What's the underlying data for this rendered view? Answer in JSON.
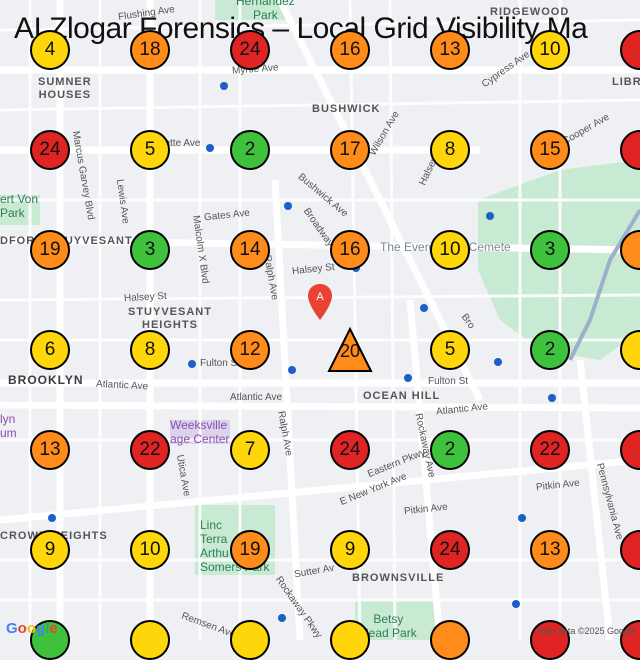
{
  "title": "AI Zlogar Forensics – Local Grid Visibility Ma",
  "colors": {
    "red": "#e02424",
    "orange": "#ff8c1a",
    "yellow": "#ffd60a",
    "green": "#3ec23e",
    "map_bg": "#eef0f3",
    "park": "#c9ead2"
  },
  "center_marker": {
    "value": "20",
    "shape": "triangle",
    "color": "orange"
  },
  "pin": {
    "label": "A"
  },
  "grid": [
    [
      "4",
      "18",
      "24",
      "16",
      "13",
      "10",
      ""
    ],
    [
      "24",
      "5",
      "2",
      "17",
      "8",
      "15",
      ""
    ],
    [
      "19",
      "3",
      "14",
      "16",
      "10",
      "3",
      ""
    ],
    [
      "6",
      "8",
      "12",
      "",
      "5",
      "2",
      ""
    ],
    [
      "13",
      "22",
      "7",
      "24",
      "2",
      "22",
      ""
    ],
    [
      "9",
      "10",
      "19",
      "9",
      "24",
      "13",
      ""
    ]
  ],
  "grid_colors": [
    [
      "yellow",
      "orange",
      "red",
      "orange",
      "orange",
      "yellow",
      "red"
    ],
    [
      "red",
      "yellow",
      "green",
      "orange",
      "yellow",
      "orange",
      "red"
    ],
    [
      "orange",
      "green",
      "orange",
      "orange",
      "yellow",
      "green",
      "orange"
    ],
    [
      "yellow",
      "yellow",
      "orange",
      "orange",
      "yellow",
      "green",
      "yellow"
    ],
    [
      "orange",
      "red",
      "yellow",
      "red",
      "green",
      "red",
      "red"
    ],
    [
      "yellow",
      "yellow",
      "orange",
      "yellow",
      "red",
      "orange",
      "red"
    ],
    [
      "green",
      "yellow",
      "yellow",
      "yellow",
      "orange",
      "red",
      "red"
    ]
  ],
  "neighborhoods": {
    "sumner_houses": "SUMNER\nHOUSES",
    "bushwick": "BUSHWICK",
    "ridgewood": "RIDGEWOOD",
    "bed_stuy": "DFORD-STUYVESANT",
    "stuyvesant_heights": "STUYVESANT\nHEIGHTS",
    "brooklyn": "BROOKLYN",
    "ocean_hill": "OCEAN HILL",
    "crown_heights": "CROWN HEIGHTS",
    "brownsville": "BROWNSVILLE",
    "libr": "LIBR"
  },
  "streets": {
    "flushing": "Flushing Ave",
    "myrtle": "Myrtle Ave",
    "wilson": "Wilson Ave",
    "cypress": "Cypress Ave",
    "cooper": "Cooper Ave",
    "lafayette": "Lafayette Ave",
    "marcus": "Marcus Garvey Blvd",
    "lewis": "Lewis Ave",
    "bushwick_ave": "Bushwick Ave",
    "gates": "Gates Ave",
    "broadway": "Broadway",
    "malcolm": "Malcolm X Blvd",
    "ralph": "Ralph Ave",
    "halsey1": "Halsey St",
    "halsey2": "Halsey St",
    "halsey3": "Halsey St",
    "fulton1": "Fulton St",
    "fulton2": "Fulton St",
    "atlantic1": "Atlantic Ave",
    "atlantic2": "Atlantic Ave",
    "atlantic3": "Atlantic Ave",
    "ralph2": "Ralph Ave",
    "rockaway": "Rockaway Ave",
    "eastern": "Eastern Pkwy",
    "eny": "E New York Ave",
    "utica": "Utica Ave",
    "pitkin1": "Pitkin Ave",
    "pitkin2": "Pitkin Ave",
    "pennsylvania": "Pennsylvania Ave",
    "sutter": "Sutter Av",
    "rockaway2": "Rockaway Pkwy",
    "remsen": "Remsen Ave",
    "evergreens": "The Evergreens Cemete",
    "broadway2": "Bro"
  },
  "pois": {
    "hernandez": "Hernandez\nPark",
    "von": "ert Von\nPark",
    "weeksville": "Weeksville\nage Center",
    "lyn_museum": "lyn\num",
    "lincoln": "Linc\nTerra\nArthu\nSomers Park",
    "betsy": "Betsy\nHead Park"
  },
  "attribution": "Map data ©2025 Google",
  "google": "Google"
}
